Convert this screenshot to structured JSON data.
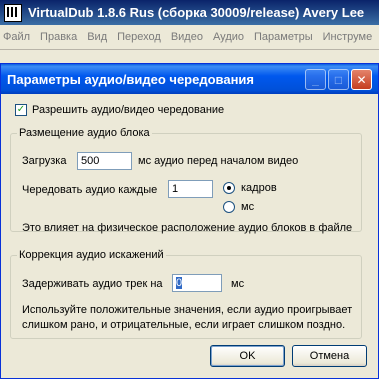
{
  "app": {
    "title": "VirtualDub 1.8.6 Rus (сборка 30009/release) Avery Lee",
    "menu": [
      "Файл",
      "Правка",
      "Вид",
      "Переход",
      "Видео",
      "Аудио",
      "Параметры",
      "Инструме"
    ]
  },
  "dialog": {
    "title": "Параметры аудио/видео чередования",
    "title_buttons": {
      "minimize": "_",
      "maximize": "□",
      "close": "✕"
    },
    "enable_checkbox": {
      "label": "Разрешить аудио/видео чередование",
      "checked": true,
      "mark": "✓"
    },
    "placement_group": {
      "legend": "Размещение аудио блока",
      "preload_label": "Загрузка",
      "preload_value": "500",
      "preload_suffix": "мс аудио перед началом видео",
      "interleave_label": "Чередовать аудио каждые",
      "interleave_value": "1",
      "unit_frames": "кадров",
      "unit_ms": "мс",
      "selected_unit": "кадров",
      "note": "Это влияет на физическое расположение аудио блоков в файле"
    },
    "skew_group": {
      "legend": "Коррекция аудио искажений",
      "delay_label": "Задерживать аудио трек на",
      "delay_value": "0",
      "delay_unit": "мс",
      "hint_line1": "Используйте положительные значения, если аудио проигрывает",
      "hint_line2": "слишком рано, и отрицательные, если играет слишком поздно."
    },
    "buttons": {
      "ok": "OK",
      "cancel": "Отмена"
    }
  }
}
